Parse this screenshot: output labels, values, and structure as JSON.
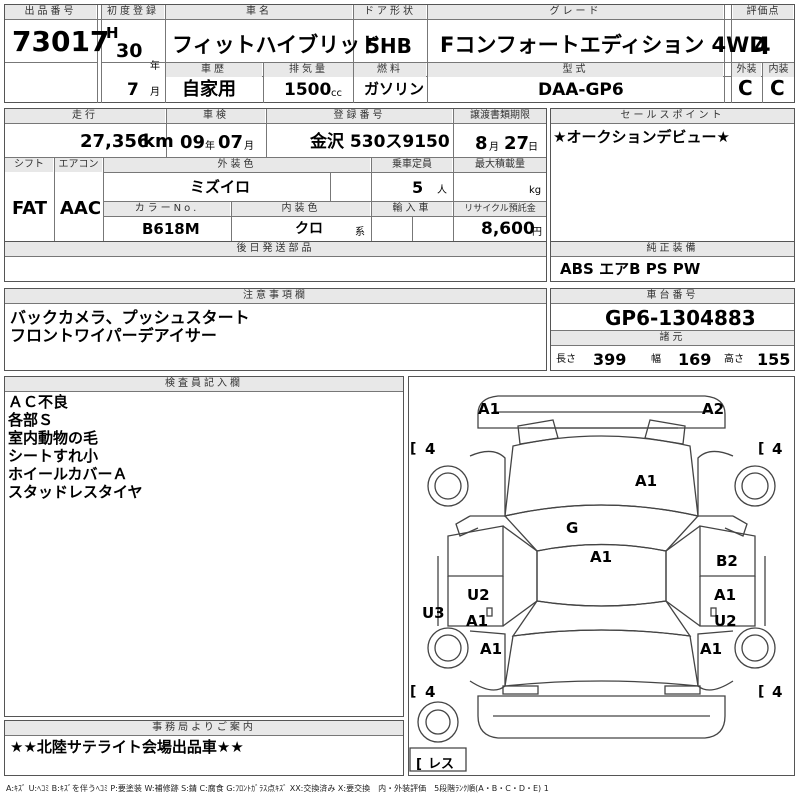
{
  "header": {
    "lot_no_label": "出品番号",
    "lot_no": "73017",
    "first_reg_label": "初度登録",
    "era": "H",
    "year": "30",
    "year_unit": "年",
    "month": "7",
    "month_unit": "月",
    "car_name_label": "車名",
    "car_name": "フィットハイブリッド",
    "door_label": "ドア形状",
    "door": "5HB",
    "grade_label": "グレード",
    "grade": "Fコンフォートエディション 4WD",
    "score_label": "評価点",
    "score": "4",
    "history_label": "車歴",
    "history": "自家用",
    "disp_label": "排気量",
    "disp": "1500",
    "disp_unit": "cc",
    "fuel_label": "燃料",
    "fuel": "ガソリン",
    "model_label": "型式",
    "model": "DAA-GP6",
    "ext_label": "外装",
    "ext": "C",
    "int_label": "内装",
    "int": "C"
  },
  "row2": {
    "mileage_label": "走行",
    "mileage": "27,356",
    "mileage_unit": "km",
    "inspection_label": "車検",
    "insp_year": "09",
    "insp_year_unit": "年",
    "insp_month": "07",
    "insp_month_unit": "月",
    "reg_label": "登録番号",
    "reg": "金沢 530ス9150",
    "transfer_label": "譲渡書類期限",
    "transfer_month": "8",
    "transfer_month_unit": "月",
    "transfer_day": "27",
    "transfer_day_unit": "日",
    "shift_label": "シフト",
    "shift": "FAT",
    "ac_label": "エアコン",
    "ac": "AAC",
    "color_label": "外装色",
    "color": "ミズイロ",
    "capacity_label": "乗車定員",
    "capacity": "5",
    "capacity_unit": "人",
    "maxload_label": "最大積載量",
    "maxload_unit": "kg",
    "colorno_label": "カラーNo.",
    "colorno": "B618M",
    "intcolor_label": "内装色",
    "intcolor": "クロ",
    "intcolor_unit": "系",
    "import_label": "輸入車",
    "recycle_label": "リサイクル預託金",
    "recycle": "8,600",
    "recycle_unit": "円",
    "later_label": "後日発送部品"
  },
  "sales": {
    "label": "セールスポイント",
    "text": "★オークションデビュー★"
  },
  "equipment": {
    "label": "純正装備",
    "text": "ABS エアB PS PW"
  },
  "notes": {
    "label": "注意事項欄",
    "line1": "バックカメラ、プッシュスタート",
    "line2": "フロントワイパーデアイサー"
  },
  "chassis": {
    "label": "車台番号",
    "value": "GP6-1304883",
    "dims_label": "諸元",
    "length_label": "長さ",
    "length": "399",
    "width_label": "幅",
    "width": "169",
    "height_label": "高さ",
    "height": "155"
  },
  "inspector": {
    "label": "検査員記入欄",
    "lines": [
      "ＡＣ不良",
      "各部Ｓ",
      "室内動物の毛",
      "シートすれ小",
      "ホイールカバーＡ",
      "スタッドレスタイヤ"
    ]
  },
  "diagram": {
    "marks": {
      "front_left": "A1",
      "front_right": "A2",
      "tire_fl": "4",
      "tire_fr": "4",
      "tire_rl": "4",
      "tire_rr": "4",
      "spare": "レス",
      "hood": "A1",
      "windshield": "G",
      "roof": "A1",
      "fr_door_right": "B2",
      "rr_door_left": "U2",
      "rr_door_left_b": "A1",
      "rocker_left": "U3",
      "rr_door_right": "A1",
      "rr_door_right_b": "U2",
      "rear_fender_left": "A1",
      "rear_fender_right": "A1"
    }
  },
  "office": {
    "label": "事務局よりご案内",
    "text": "★★北陸サテライト会場出品車★★"
  },
  "legend": "A:ｷｽﾞ U:ﾍｺﾐ B:ｷｽﾞを伴うﾍｺﾐ P:要塗装 W:補修跡 S:錆 C:腐食 G:ﾌﾛﾝﾄｶﾞﾗｽ点ｷｽﾞ XX:交換済み X:要交換　内・外装評価　5段階ﾗﾝｸ順(A・B・C・D・E) 1"
}
